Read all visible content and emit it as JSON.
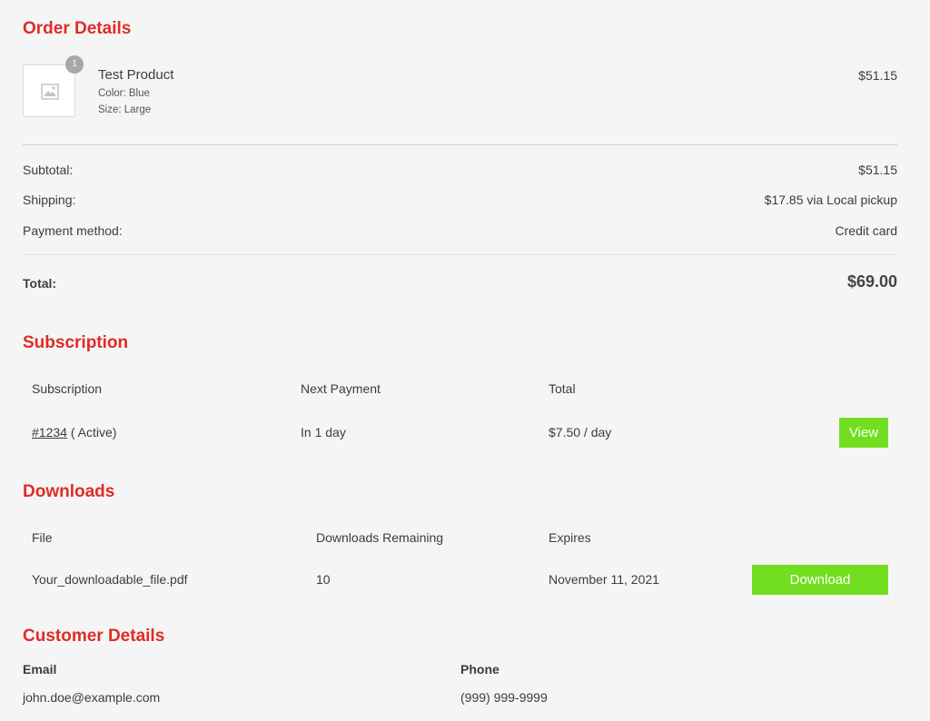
{
  "order_details": {
    "title": "Order Details",
    "item": {
      "name": "Test Product",
      "color": "Color: Blue",
      "size": "Size: Large",
      "price": "$51.15",
      "quantity": "1",
      "image_icon": "image-placeholder-icon"
    },
    "totals": {
      "subtotal_label": "Subtotal:",
      "subtotal_value": "$51.15",
      "shipping_label": "Shipping:",
      "shipping_value": "$17.85 via Local pickup",
      "payment_label": "Payment method:",
      "payment_value": "Credit card",
      "total_label": "Total:",
      "total_value": "$69.00"
    }
  },
  "subscription": {
    "title": "Subscription",
    "headers": [
      "Subscription",
      "Next Payment",
      "Total"
    ],
    "row": {
      "id": "#1234",
      "status": "( Active)",
      "next_payment": "In 1 day",
      "total": "$7.50 / day",
      "action_label": "View"
    }
  },
  "downloads": {
    "title": "Downloads",
    "headers": [
      "File",
      "Downloads Remaining",
      "Expires"
    ],
    "row": {
      "file": "Your_downloadable_file.pdf",
      "remaining": "10",
      "expires": "November 11, 2021",
      "action_label": "Download"
    }
  },
  "customer": {
    "title": "Customer Details",
    "email_label": "Email",
    "email_value": "john.doe@example.com",
    "phone_label": "Phone",
    "phone_value": "(999) 999-9999"
  },
  "colors": {
    "heading": "#e02b27",
    "button": "#71de1f",
    "text": "#3c3c3c",
    "background": "#f5f5f5"
  }
}
